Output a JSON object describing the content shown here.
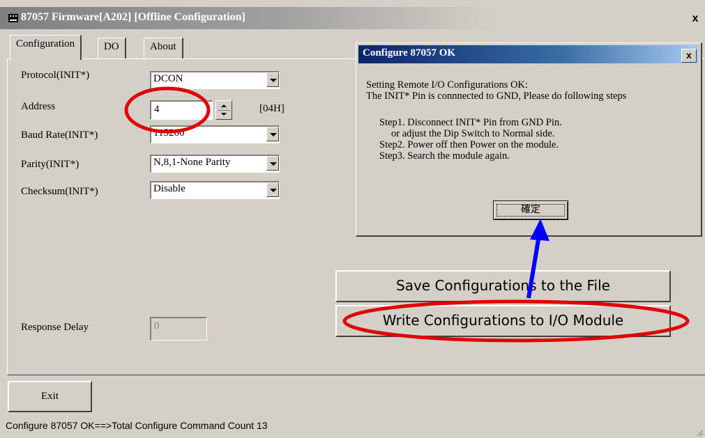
{
  "window": {
    "title": "87057 Firmware[A202] [Offline Configuration]",
    "close_label": "x"
  },
  "tabs": [
    {
      "label": "Configuration",
      "active": true
    },
    {
      "label": "DO",
      "active": false
    },
    {
      "label": "About",
      "active": false
    }
  ],
  "config": {
    "protocol": {
      "label": "Protocol(INIT*)",
      "value": "DCON"
    },
    "address": {
      "label": "Address",
      "value": "4",
      "hex": "[04H]"
    },
    "baud_rate": {
      "label": "Baud Rate(INIT*)",
      "value": "115200"
    },
    "parity": {
      "label": "Parity(INIT*)",
      "value": "N,8,1-None Parity"
    },
    "checksum": {
      "label": "Checksum(INIT*)",
      "value": "Disable"
    },
    "response_delay": {
      "label": "Response Delay",
      "value": "0"
    }
  },
  "buttons": {
    "save": "Save Configurations to the File",
    "write": "Write Configurations to I/O Module",
    "exit": "Exit"
  },
  "status_bar": "Configure 87057 OK==>Total Configure Command Count 13",
  "dialog": {
    "title": "Configure 87057 OK",
    "close_label": "x",
    "lines": [
      "Setting Remote I/O Configurations OK:",
      "The INIT* Pin is connnected to GND, Please do following steps",
      "Step1. Disconnect INIT* Pin from GND Pin.",
      "or adjust the Dip Switch to Normal side.",
      "Step2. Power off then Power on the module.",
      "Step3. Search the module again."
    ],
    "ok_label": "確定"
  },
  "colors": {
    "annotation_ellipse": "#e00000",
    "annotation_arrow": "#0000ff",
    "window_bg": "#d4d0c8",
    "dialog_title_bg": "#0a246a"
  }
}
